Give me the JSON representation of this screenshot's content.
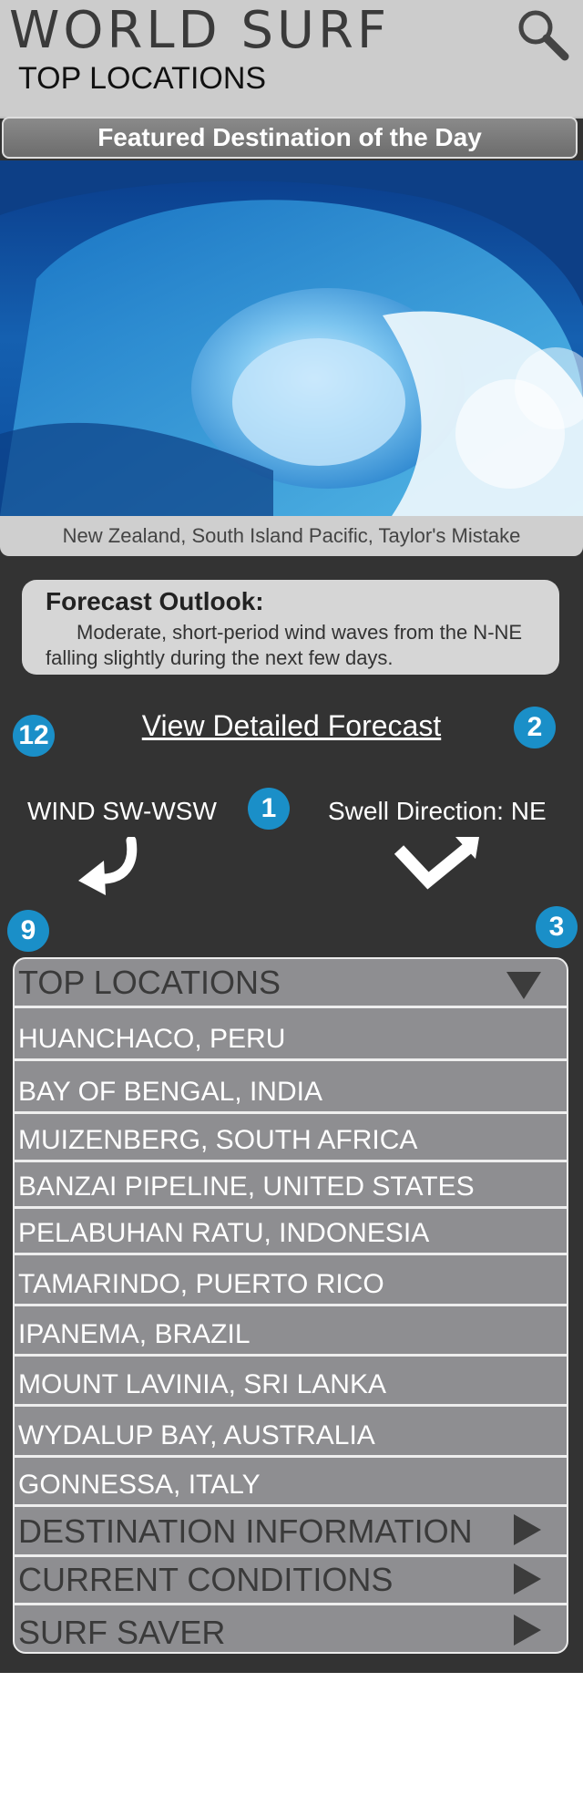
{
  "header": {
    "title": "WORLD SURF",
    "subtitle": "TOP LOCATIONS",
    "search_icon": "search-icon"
  },
  "featured": {
    "label": "Featured Destination of the Day",
    "image": "breaking-wave-photo",
    "caption": "New Zealand, South Island Pacific, Taylor's Mistake"
  },
  "forecast": {
    "title": "Forecast Outlook:",
    "text": "Moderate, short-period wind waves from the N-NE falling slightly during the next few days."
  },
  "detailed_link": "View Detailed Forecast",
  "badges": {
    "b12": "12",
    "b2": "2",
    "b1": "1",
    "b9": "9",
    "b3": "3"
  },
  "wind": {
    "label": "WIND SW-WSW",
    "icon": "curved-arrow-icon"
  },
  "swell": {
    "label": "Swell Direction: NE",
    "icon": "check-arrow-icon"
  },
  "accordion": {
    "top_locations": "TOP LOCATIONS",
    "locations": [
      "HUANCHACO, PERU",
      "BAY OF BENGAL, INDIA",
      "MUIZENBERG, SOUTH AFRICA",
      "BANZAI PIPELINE, UNITED STATES",
      "PELABUHAN RATU, INDONESIA",
      "TAMARINDO, PUERTO RICO",
      "IPANEMA, BRAZIL",
      "MOUNT LAVINIA, SRI LANKA",
      "WYDALUP BAY, AUSTRALIA",
      "GONNESSA, ITALY"
    ],
    "sections": [
      "DESTINATION INFORMATION",
      "CURRENT CONDITIONS",
      "SURF SAVER"
    ]
  },
  "colors": {
    "background": "#333333",
    "header": "#cccccc",
    "badge": "#1a8fc8",
    "accordion": "#8e8e91"
  }
}
